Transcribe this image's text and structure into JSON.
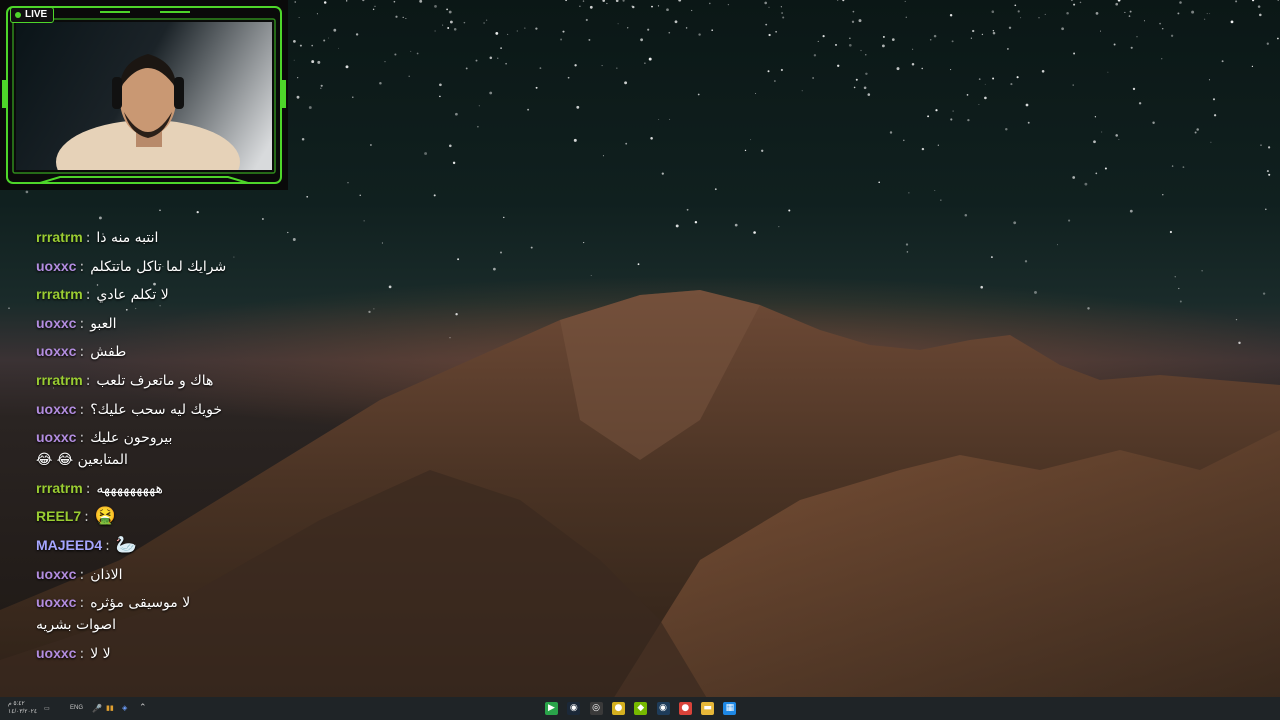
{
  "stream": {
    "live_label": "LIVE"
  },
  "chat": {
    "messages": [
      {
        "user": "rrratrm",
        "color": "#9acd32",
        "text": "انتبه منه ذا"
      },
      {
        "user": "uoxxc",
        "color": "#b38de0",
        "text": "شرايك لما تاكل ماتتكلم"
      },
      {
        "user": "rrratrm",
        "color": "#9acd32",
        "text": "لا تكلم عادي"
      },
      {
        "user": "uoxxc",
        "color": "#b38de0",
        "text": "العبو"
      },
      {
        "user": "uoxxc",
        "color": "#b38de0",
        "text": "طفش"
      },
      {
        "user": "rrratrm",
        "color": "#9acd32",
        "text": "هاك و ماتعرف تلعب"
      },
      {
        "user": "uoxxc",
        "color": "#b38de0",
        "text": "خويك ليه سحب عليك؟"
      },
      {
        "user": "uoxxc",
        "color": "#b38de0",
        "text": "بيروحون عليك",
        "text2": "المتابعين 😂 😂"
      },
      {
        "user": "rrratrm",
        "color": "#9acd32",
        "text": "هههههههههه"
      },
      {
        "user": "REEL7",
        "color": "#9acd32",
        "text": "🤮"
      },
      {
        "user": "MAJEED4",
        "color": "#a6a6ff",
        "text": "🦢"
      },
      {
        "user": "uoxxc",
        "color": "#b38de0",
        "text": "الاذان"
      },
      {
        "user": "uoxxc",
        "color": "#b38de0",
        "text": "لا موسيقى مؤثره",
        "text2": "اصوات بشريه"
      },
      {
        "user": "uoxxc",
        "color": "#b38de0",
        "text": "لا لا"
      }
    ]
  },
  "taskbar": {
    "clock_time": "٥:٤٢ م",
    "clock_date": "١٤/٠٣/٢٠٢٤",
    "language": "ENG",
    "tray_icons": [
      "microphone-icon",
      "battery-icon",
      "network-icon",
      "chevron-up-icon"
    ],
    "apps": [
      {
        "name": "media-player-icon",
        "glyph": "▶",
        "color": "#2aa44a"
      },
      {
        "name": "steam-icon",
        "glyph": "◉",
        "color": "#1b2838"
      },
      {
        "name": "obs-icon",
        "glyph": "◎",
        "color": "#3a3a3a"
      },
      {
        "name": "discord-overlay-icon",
        "glyph": "●",
        "color": "#d4b020"
      },
      {
        "name": "nvidia-icon",
        "glyph": "◆",
        "color": "#76b900"
      },
      {
        "name": "steam-launcher-icon",
        "glyph": "◉",
        "color": "#1e3c5a"
      },
      {
        "name": "chrome-icon",
        "glyph": "●",
        "color": "#d8433a"
      },
      {
        "name": "file-explorer-icon",
        "glyph": "▬",
        "color": "#e6b739"
      },
      {
        "name": "windows-icon",
        "glyph": "▦",
        "color": "#1e88e5"
      }
    ]
  }
}
